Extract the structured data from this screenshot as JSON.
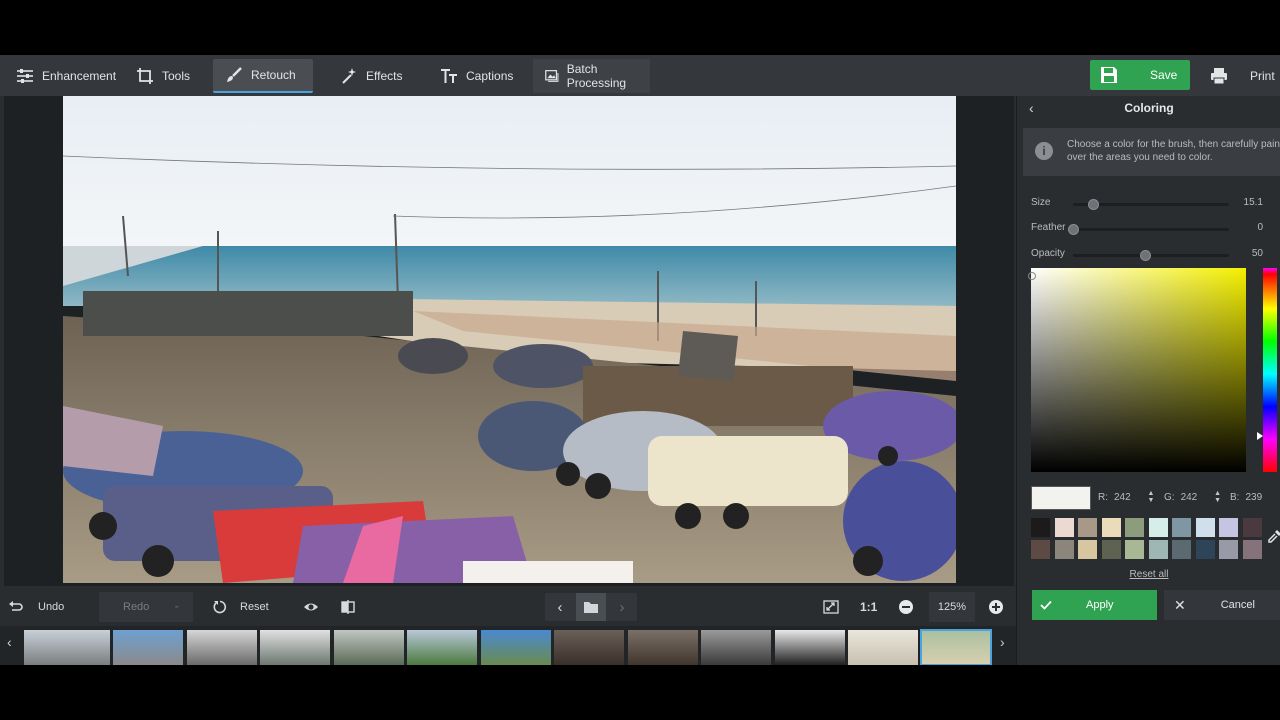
{
  "toolbar": {
    "enhancement": "Enhancement",
    "tools": "Tools",
    "retouch": "Retouch",
    "effects": "Effects",
    "captions": "Captions",
    "batch": "Batch Processing",
    "save": "Save",
    "print": "Print"
  },
  "bottom": {
    "undo": "Undo",
    "redo": "Redo",
    "reset": "Reset",
    "one_to_one": "1:1",
    "zoom": "125%"
  },
  "panel": {
    "title": "Coloring",
    "info": "Choose a color for the brush, then carefully paint over the areas you need to color.",
    "size_label": "Size",
    "size_value": "15.1",
    "size_level": 0.13,
    "feather_label": "Feather",
    "feather_value": "0",
    "feather_level": 0.0,
    "opacity_label": "Opacity",
    "opacity_value": "50",
    "opacity_level": 0.46,
    "r_label": "R:",
    "r_value": "242",
    "g_label": "G:",
    "g_value": "242",
    "b_label": "B:",
    "b_value": "239",
    "current_color": "#f2f2ef",
    "palette": [
      "#1c1a1a",
      "#ecd9d2",
      "#a89888",
      "#eadcba",
      "#8e9c7e",
      "#d6eee8",
      "#7f97a4",
      "#cfe0ec",
      "#c5c4e2",
      "#4a3a40",
      "#5e4a44",
      "#8c857c",
      "#d8c6a0",
      "#5e6250",
      "#a9b894",
      "#9fb7b4",
      "#5b6a70",
      "#2e4458",
      "#989aa8",
      "#86727a"
    ],
    "reset_all": "Reset all",
    "apply": "Apply",
    "cancel": "Cancel"
  },
  "accent": "#4aa3df",
  "green": "#2fa352"
}
